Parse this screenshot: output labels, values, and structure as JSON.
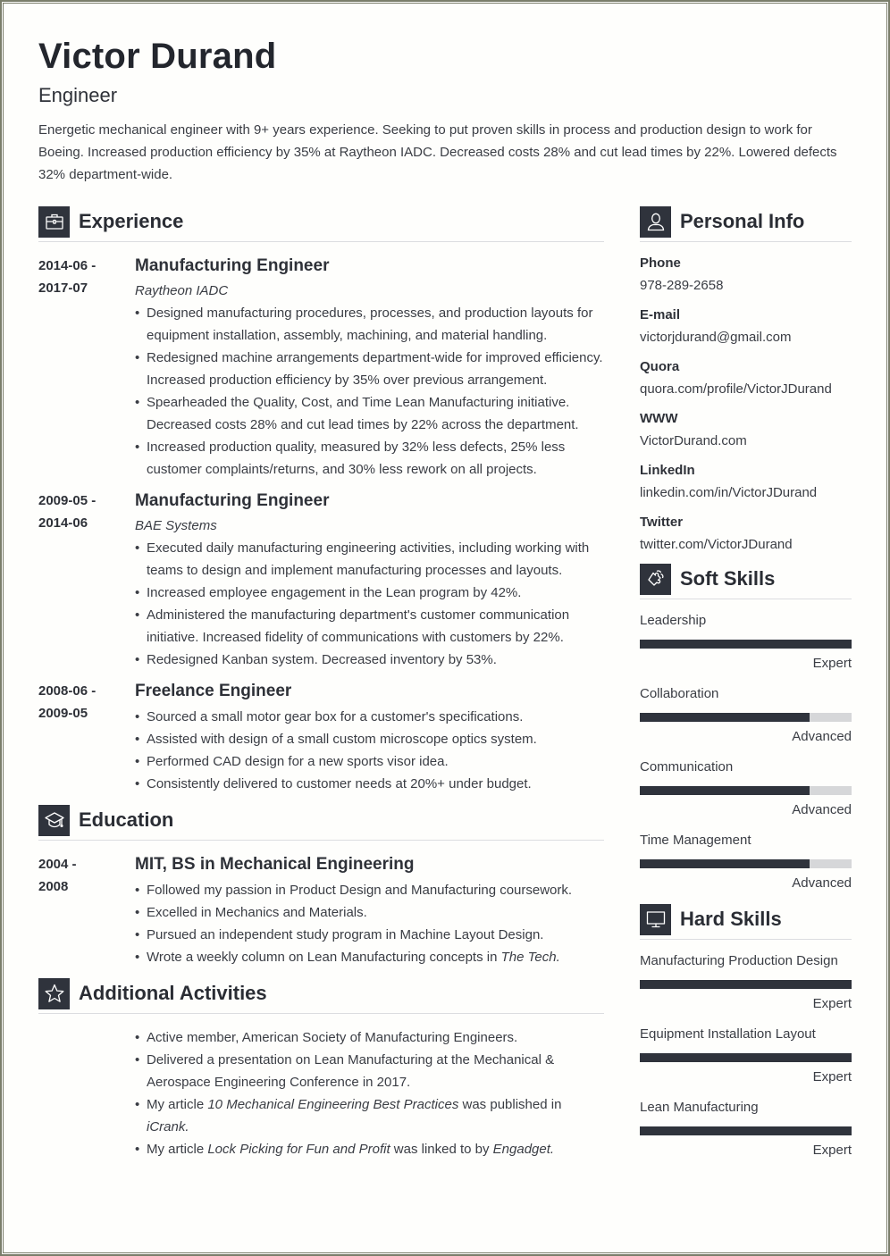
{
  "header": {
    "name": "Victor Durand",
    "role": "Engineer",
    "summary": "Energetic mechanical engineer with 9+ years experience. Seeking to put proven skills in process and production design to work for Boeing. Increased production efficiency by 35% at Raytheon IADC. Decreased costs 28% and cut lead times by 22%. Lowered defects 32% department-wide."
  },
  "experience": {
    "title": "Experience",
    "icon": "briefcase-icon",
    "entries": [
      {
        "date_start": "2014-06 -",
        "date_end": "2017-07",
        "title": "Manufacturing Engineer",
        "org": "Raytheon IADC",
        "bullets": [
          "Designed manufacturing procedures, processes, and production layouts for equipment installation, assembly, machining, and material handling.",
          "Redesigned machine arrangements department-wide for improved efficiency. Increased production efficiency by 35% over previous arrangement.",
          "Spearheaded the Quality, Cost, and Time Lean Manufacturing initiative. Decreased costs 28% and cut lead times by 22% across the department.",
          "Increased production quality, measured by 32% less defects, 25% less customer complaints/returns, and 30% less rework on all projects."
        ]
      },
      {
        "date_start": "2009-05 -",
        "date_end": "2014-06",
        "title": "Manufacturing Engineer",
        "org": "BAE Systems",
        "bullets": [
          "Executed daily manufacturing engineering activities, including working with teams to design and implement manufacturing processes and layouts.",
          "Increased employee engagement in the Lean program by 42%.",
          "Administered the manufacturing department's customer communication initiative. Increased fidelity of communications with customers by 22%.",
          "Redesigned Kanban system. Decreased inventory by 53%."
        ]
      },
      {
        "date_start": "2008-06 -",
        "date_end": "2009-05",
        "title": "Freelance Engineer",
        "org": "",
        "bullets": [
          "Sourced a small motor gear box for a customer's specifications.",
          "Assisted with design of a small custom microscope optics system.",
          "Performed CAD design for a new sports visor idea.",
          "Consistently delivered to customer needs at 20%+ under budget."
        ]
      }
    ]
  },
  "education": {
    "title": "Education",
    "icon": "graduation-cap-icon",
    "date_start": "2004 -",
    "date_end": "2008",
    "degree": "MIT, BS in Mechanical Engineering",
    "bullets": [
      "Followed my passion in Product Design and Manufacturing coursework.",
      "Excelled in Mechanics and Materials.",
      "Pursued an independent study program in Machine Layout Design."
    ],
    "last_bullet_prefix": "Wrote a weekly column on Lean Manufacturing concepts in ",
    "last_bullet_italic": "The Tech."
  },
  "activities": {
    "title": "Additional Activities",
    "icon": "star-icon",
    "b1": "Active member, American Society of Manufacturing Engineers.",
    "b2": "Delivered a presentation on Lean Manufacturing at the Mechanical & Aerospace Engineering Conference in 2017.",
    "b3_pre": "My article ",
    "b3_italic": "10 Mechanical Engineering Best Practices",
    "b3_mid": " was published in ",
    "b3_italic2": "iCrank.",
    "b4_pre": "My article ",
    "b4_italic": "Lock Picking for Fun and Profit",
    "b4_mid": " was linked to by ",
    "b4_italic2": "Engadget."
  },
  "personal_info": {
    "title": "Personal Info",
    "icon": "user-icon",
    "items": [
      {
        "label": "Phone",
        "value": "978-289-2658"
      },
      {
        "label": "E-mail",
        "value": "victorjdurand@gmail.com"
      },
      {
        "label": "Quora",
        "value": "quora.com/profile/VictorJDurand"
      },
      {
        "label": "WWW",
        "value": "VictorDurand.com"
      },
      {
        "label": "LinkedIn",
        "value": "linkedin.com/in/VictorJDurand"
      },
      {
        "label": "Twitter",
        "value": "twitter.com/VictorJDurand"
      }
    ]
  },
  "soft_skills": {
    "title": "Soft Skills",
    "icon": "puzzle-icon",
    "items": [
      {
        "name": "Leadership",
        "level": "Expert",
        "fill": 1.0
      },
      {
        "name": "Collaboration",
        "level": "Advanced",
        "fill": 0.8
      },
      {
        "name": "Communication",
        "level": "Advanced",
        "fill": 0.8
      },
      {
        "name": "Time Management",
        "level": "Advanced",
        "fill": 0.8
      }
    ]
  },
  "hard_skills": {
    "title": "Hard Skills",
    "icon": "monitor-icon",
    "items": [
      {
        "name": "Manufacturing Production Design",
        "level": "Expert",
        "fill": 1.0
      },
      {
        "name": "Equipment Installation Layout",
        "level": "Expert",
        "fill": 1.0
      },
      {
        "name": "Lean Manufacturing",
        "level": "Expert",
        "fill": 1.0
      }
    ]
  },
  "colors": {
    "accent": "#2f333c",
    "bar_track": "#d6d7d9",
    "frame": "#7a7d6a"
  }
}
